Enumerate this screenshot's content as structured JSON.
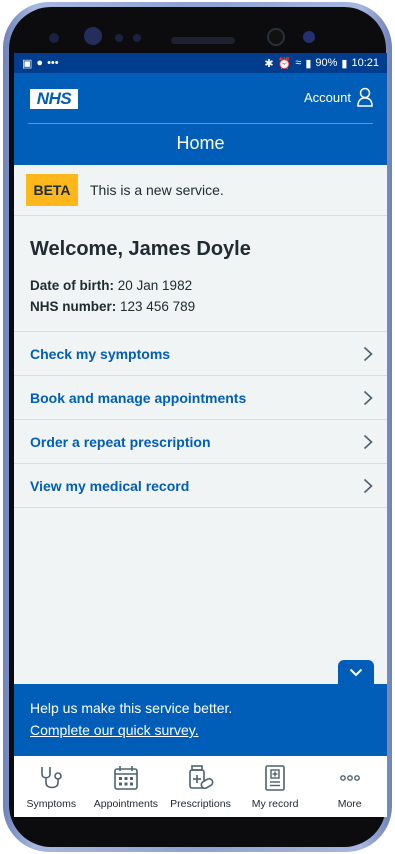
{
  "statusbar": {
    "battery": "90%",
    "time": "10:21"
  },
  "header": {
    "logo": "NHS",
    "account_label": "Account",
    "title": "Home"
  },
  "beta": {
    "tag": "BETA",
    "text": "This is a new service."
  },
  "user": {
    "welcome": "Welcome, James Doyle",
    "dob_label": "Date of birth:",
    "dob_value": "20 Jan 1982",
    "nhs_label": "NHS number:",
    "nhs_value": "123 456 789"
  },
  "menu": [
    {
      "label": "Check my symptoms"
    },
    {
      "label": "Book and manage appointments"
    },
    {
      "label": "Order a repeat prescription"
    },
    {
      "label": "View my medical record"
    }
  ],
  "survey": {
    "text": "Help us make this service better.",
    "link": "Complete our quick survey."
  },
  "tabs": [
    {
      "label": "Symptoms",
      "icon": "stethoscope-icon"
    },
    {
      "label": "Appointments",
      "icon": "calendar-icon"
    },
    {
      "label": "Prescriptions",
      "icon": "pills-icon"
    },
    {
      "label": "My record",
      "icon": "record-icon"
    },
    {
      "label": "More",
      "icon": "more-icon"
    }
  ],
  "colors": {
    "nhs_blue": "#005eb8",
    "beta_yellow": "#ffb81c",
    "background": "#f0f4f5",
    "text": "#212b32"
  }
}
